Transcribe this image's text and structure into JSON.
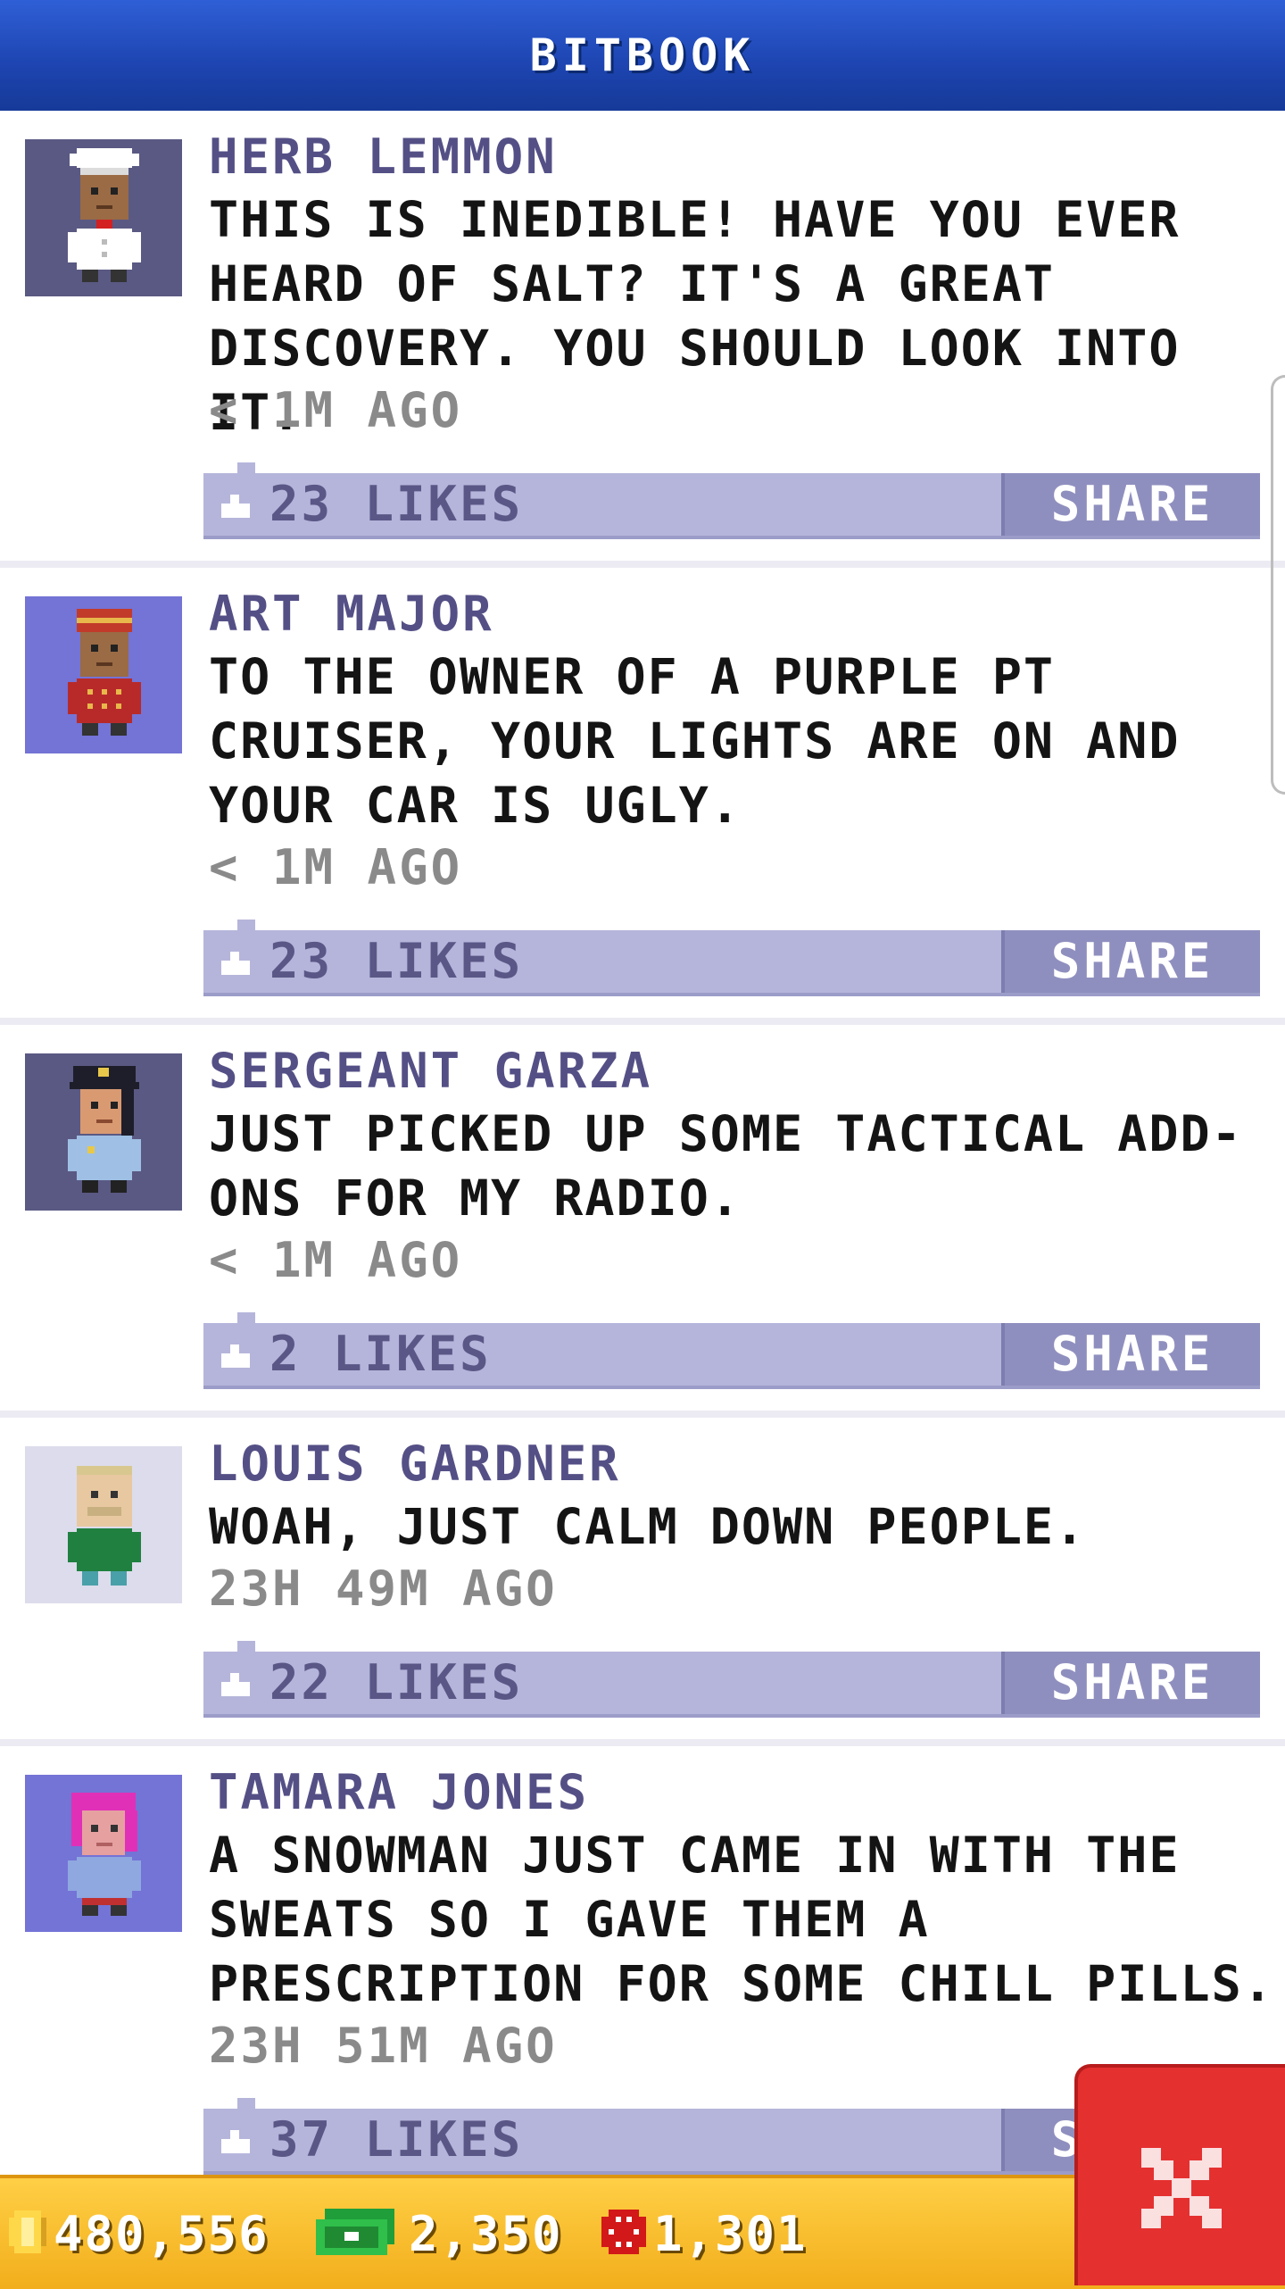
{
  "header": {
    "title": "BITBOOK"
  },
  "posts": [
    {
      "name": "HERB LEMMON",
      "body": "THIS IS INEDIBLE! HAVE YOU EVER HEARD OF SALT? IT'S A GREAT DISCOVERY. YOU SHOULD LOOK INTO IT.",
      "time": "< 1M AGO",
      "likes": "23 LIKES",
      "share": "SHARE",
      "avatar": "chef-avatar-icon"
    },
    {
      "name": "ART MAJOR",
      "body": "TO THE OWNER OF A PURPLE PT CRUISER, YOUR LIGHTS ARE ON AND YOUR CAR IS UGLY.",
      "time": "< 1M AGO",
      "likes": "23 LIKES",
      "share": "SHARE",
      "avatar": "bellhop-avatar-icon"
    },
    {
      "name": "SERGEANT GARZA",
      "body": "JUST PICKED UP SOME TACTICAL ADD-ONS FOR MY RADIO.",
      "time": "< 1M AGO",
      "likes": "2 LIKES",
      "share": "SHARE",
      "avatar": "police-avatar-icon"
    },
    {
      "name": "LOUIS GARDNER",
      "body": "WOAH, JUST CALM DOWN PEOPLE.",
      "time": "23H 49M AGO",
      "likes": "22 LIKES",
      "share": "SHARE",
      "avatar": "bald-man-avatar-icon"
    },
    {
      "name": "TAMARA JONES",
      "body": "A SNOWMAN JUST CAME IN WITH THE SWEATS SO I GAVE THEM A PRESCRIPTION FOR SOME CHILL PILLS.",
      "time": "23H 51M AGO",
      "likes": "37 LIKES",
      "share": "SHARE",
      "avatar": "pink-hair-woman-avatar-icon"
    }
  ],
  "resources": {
    "coins": "480,556",
    "bux": "2,350",
    "tickets": "1,301"
  },
  "colors": {
    "header": "#1d44b0",
    "likes_bar": "#b5b5db",
    "share_button": "#8f8fbf",
    "name_text": "#545086",
    "bottom_bar": "#f5b52a",
    "close_button": "#e53030"
  }
}
